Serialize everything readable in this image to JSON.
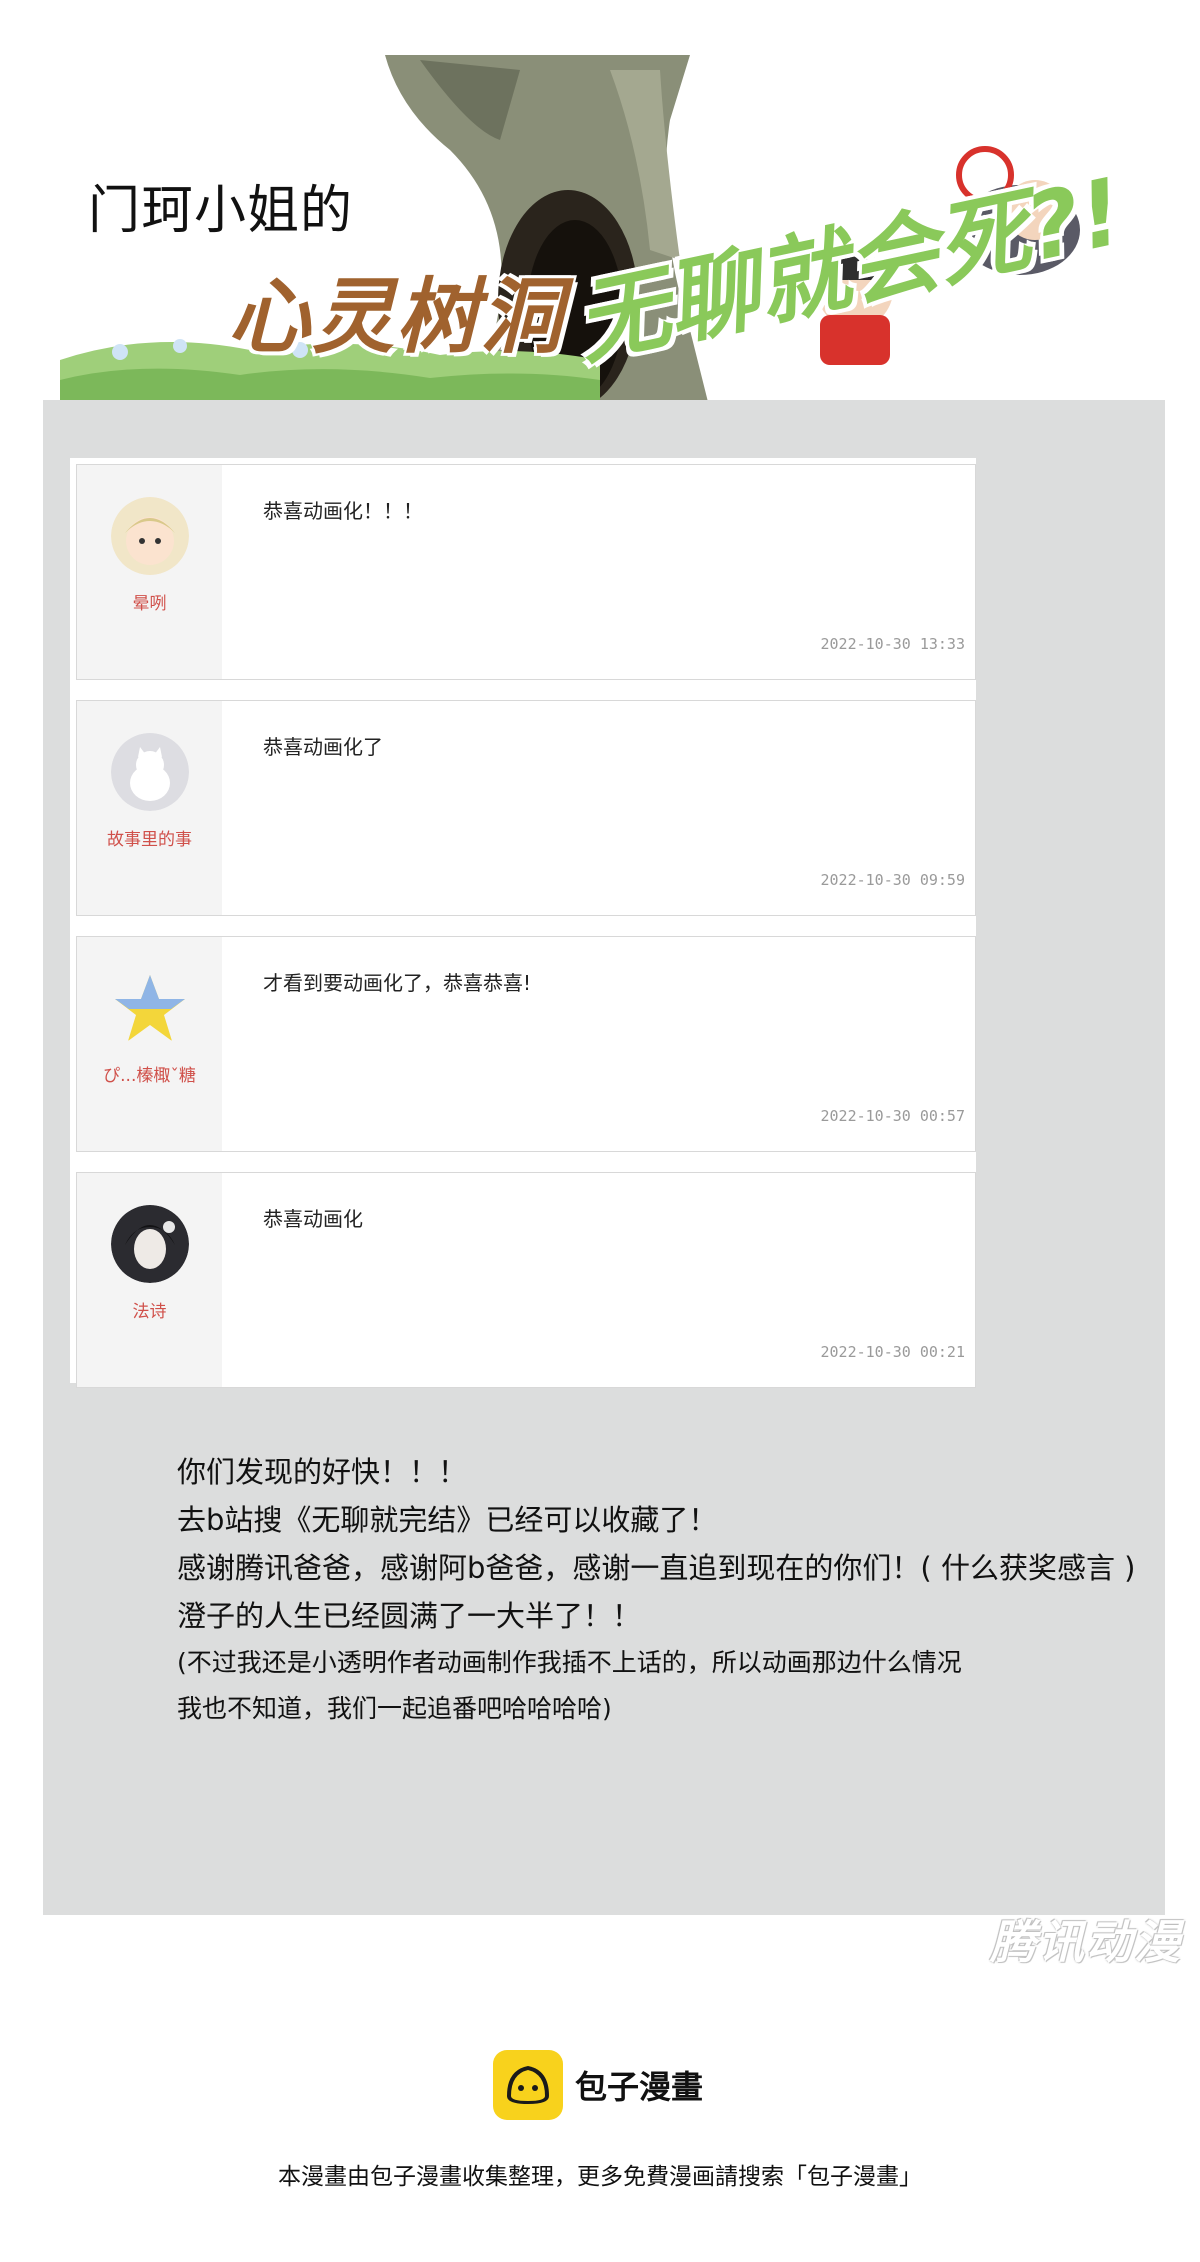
{
  "banner": {
    "subtitle": "门珂小姐的",
    "title": "心灵树洞",
    "series_title": "无聊就会死?!"
  },
  "comments": [
    {
      "user": "晕咧",
      "text": "恭喜动画化！！！",
      "time": "2022-10-30 13:33",
      "avatar": "girl-avatar"
    },
    {
      "user": "故事里的事",
      "text": "恭喜动画化了",
      "time": "2022-10-30 09:59",
      "avatar": "white-cat-avatar"
    },
    {
      "user": "ぴ...榛棷ˇ糖",
      "text": "才看到要动画化了，恭喜恭喜!",
      "time": "2022-10-30 00:57",
      "avatar": "star-avatar"
    },
    {
      "user": "法诗",
      "text": "恭喜动画化",
      "time": "2022-10-30 00:21",
      "avatar": "dark-hair-avatar"
    }
  ],
  "message": {
    "lines": [
      "你们发现的好快！！！",
      "去b站搜《无聊就完结》已经可以收藏了！",
      "感谢腾讯爸爸，感谢阿b爸爸，感谢一直追到现在的你们！( 什么获奖感言 )",
      "澄子的人生已经圆满了一大半了！！"
    ],
    "small_lines": [
      "(不过我还是小透明作者动画制作我插不上话的，所以动画那边什么情况",
      "我也不知道，我们一起追番吧哈哈哈哈)"
    ]
  },
  "watermark": "腾讯动漫",
  "footer": {
    "logo_text": "包子漫畫",
    "note": "本漫畫由包子漫畫收集整理，更多免費漫画請搜索「包子漫畫」"
  },
  "colors": {
    "panel": "#dcdddd",
    "username": "#d0504a",
    "title_brown": "#a0622e",
    "title_green": "#8ac95a",
    "logo_yellow": "#f8d21c"
  }
}
